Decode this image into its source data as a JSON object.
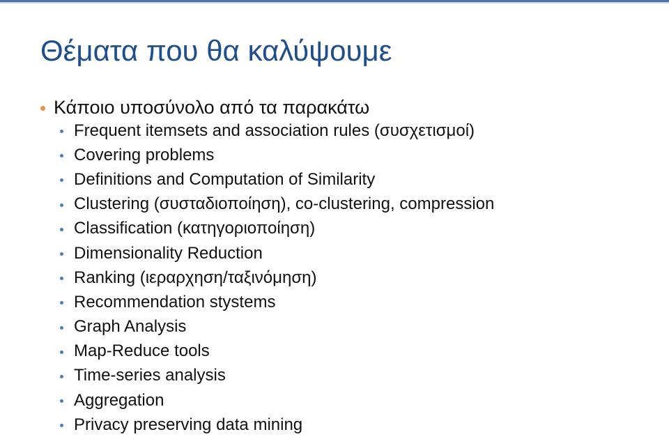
{
  "slide": {
    "title": "Θέματα που θα καλύψουμε",
    "accent_colors": {
      "title": "#1f4e8c",
      "top_bar": "#4f72a8",
      "level1_bullet": "#e8914a",
      "level2_bullet": "#4f7bb8"
    },
    "main_point": "Κάποιο υποσύνολο από τα παρακάτω",
    "topics": [
      "Frequent itemsets and association rules (συσχετισμοί)",
      "Covering problems",
      "Definitions and Computation of Similarity",
      "Clustering (συσταδιοποίηση), co-clustering, compression",
      "Classification (κατηγοριοποίηση)",
      "Dimensionality Reduction",
      "Ranking (ιεραρχηση/ταξινόμηση)",
      "Recommendation stystems",
      "Graph Analysis",
      "Map-Reduce tools",
      "Time-series analysis",
      "Aggregation",
      "Privacy preserving data mining"
    ]
  }
}
